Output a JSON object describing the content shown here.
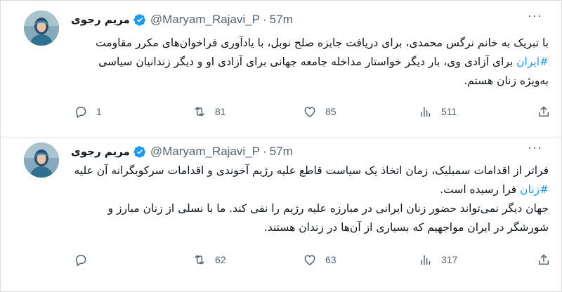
{
  "tweets": [
    {
      "author": {
        "name": "مریم رجوی",
        "handle": "@Maryam_Rajavi_P",
        "separator": "·",
        "time": "57m"
      },
      "paragraphs": [
        [
          "با تبریک به خانم نرگس محمدی، برای دریافت جایزه صلح نوبل، با یادآوری فراخوان‌های مکرر مقاومت ",
          "#ایران",
          " برای آزادی وی، بار دیگر خواستار مداخله جامعه جهانی برای آزادی او و دیگر زندانیان سیاسی به‌ویژه زنان هستم."
        ]
      ],
      "stats": {
        "replies": "1",
        "retweets": "81",
        "likes": "85",
        "views": "511"
      }
    },
    {
      "author": {
        "name": "مریم رجوی",
        "handle": "@Maryam_Rajavi_P",
        "separator": "·",
        "time": "57m"
      },
      "paragraphs": [
        [
          "فراتر از اقدامات سمبلیک، زمان اتخاذ یک سیاست قاطع علیه رژیم آخوندی و اقدامات سرکوبگرانه آن علیه ",
          "#زنان",
          " فرا رسیده است."
        ],
        [
          "جهان دیگر نمی‌تواند حضور زنان ایرانی در مبارزه علیه رژیم را نفی کند. ما با نسلی از زنان مبارز و شورشگر در ایران مواجهیم که بسیاری از آن‌ها در زندان هستند.",
          "",
          ""
        ]
      ],
      "stats": {
        "replies": "",
        "retweets": "62",
        "likes": "63",
        "views": "317"
      }
    }
  ],
  "icons": {
    "more": "more-dots-icon",
    "verified": "verified-badge-icon",
    "reply": "reply-icon",
    "retweet": "retweet-icon",
    "like": "heart-icon",
    "views": "views-chart-icon",
    "share": "share-icon"
  },
  "colors": {
    "text": "#0f1419",
    "secondary": "#536471",
    "hashtag": "#1d9bf0",
    "verified": "#1d9bf0"
  }
}
